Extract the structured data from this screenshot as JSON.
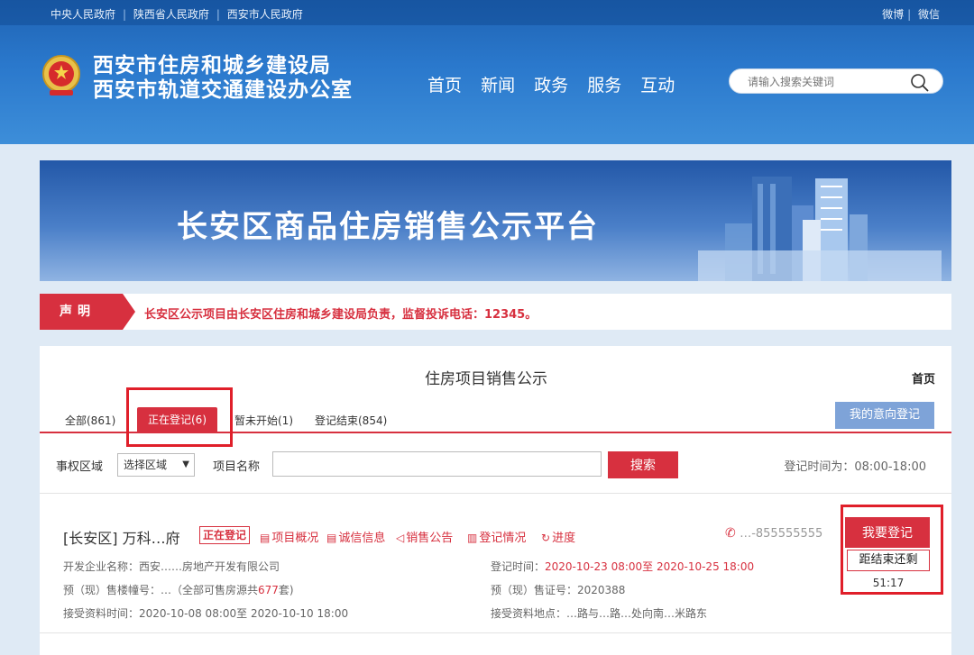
{
  "topbar": {
    "links": [
      "中央人民政府",
      "陕西省人民政府",
      "西安市人民政府"
    ],
    "right": [
      "微博",
      "微信"
    ]
  },
  "header": {
    "org_line1": "西安市住房和城乡建设局",
    "org_line2": "西安市轨道交通建设办公室",
    "nav": [
      "首页",
      "新闻",
      "政务",
      "服务",
      "互动"
    ],
    "search_placeholder": "请输入搜索关键词"
  },
  "banner": {
    "title": "长安区商品住房销售公示平台"
  },
  "notice": {
    "tag": "声明",
    "text": "长安区公示项目由长安区住房和城乡建设局负责，监督投诉电话：12345。"
  },
  "panel": {
    "title": "住房项目销售公示",
    "home": "首页",
    "tabs": [
      "全部(861)",
      "正在登记(6)",
      "暂未开始(1)",
      "登记结束(854)"
    ],
    "intent_button": "我的意向登记",
    "filter": {
      "district_label": "事权区域",
      "district_value": "选择区域",
      "project_label": "项目名称",
      "search_button": "搜索",
      "hours": "登记时间为：08:00-18:00"
    },
    "project": {
      "name": "[长安区] 万科…府",
      "status_badge": "正在登记",
      "links": [
        "项目概况",
        "诚信信息",
        "销售公告",
        "登记情况",
        "进度"
      ],
      "phone": "…-855555555",
      "developer": "开发企业名称：西安……房地产开发有限公司",
      "buildings_prefix": "预（现）售楼幢号：…（全部可售房源共",
      "buildings_count": "677",
      "buildings_suffix": "套)",
      "accept_time": "接受资料时间：2020-10-08 08:00至 2020-10-10 18:00",
      "reg_label": "登记时间：",
      "reg_time": "2020-10-23 08:00至 2020-10-25 18:00",
      "permit": "预（现）售证号：2020388",
      "accept_place": "接受资料地点：…路与…路…处向南…米路东",
      "register_button": "我要登记",
      "countdown_label": "距结束还剩",
      "countdown_value": "51:17"
    }
  }
}
